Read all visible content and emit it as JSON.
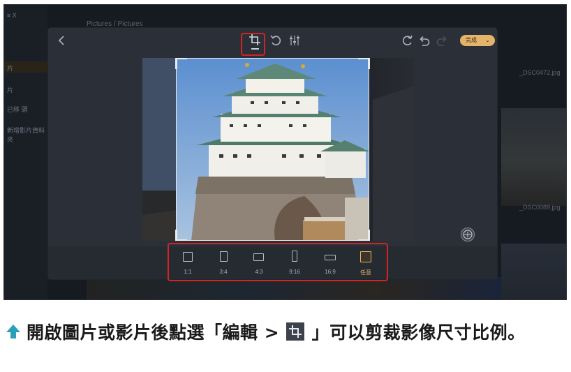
{
  "background": {
    "breadcrumb": "Pictures / Pictures",
    "sidebar_rows": [
      "≡  X",
      "片",
      "片",
      "已移 頭",
      "新增影片資料夾"
    ],
    "file_names": [
      "_DSC0472.jpg",
      "_DSC0089.jpg"
    ]
  },
  "editor": {
    "toolbar": {
      "back_icon": "chevron-left-icon",
      "crop_icon": "crop-icon",
      "rotate_icon": "rotate-icon",
      "adjust_icon": "adjust-icon",
      "redo_icon": "redo-icon",
      "undo_icon": "undo-icon",
      "done_label": "完成",
      "done_chevron": "⌄"
    },
    "ratios": [
      {
        "label": "1:1",
        "icon": "square-icon"
      },
      {
        "label": "3:4",
        "icon": "portrait-icon"
      },
      {
        "label": "4:3",
        "icon": "landscape-icon"
      },
      {
        "label": "9:16",
        "icon": "tall-portrait-icon"
      },
      {
        "label": "16:9",
        "icon": "wide-landscape-icon"
      },
      {
        "label": "任意",
        "icon": "freeform-icon",
        "selected": true
      }
    ],
    "compass_icon": "straighten-icon"
  },
  "caption": {
    "part1": "開啟圖片或影片後點選「編輯 > ",
    "part2": " 」可以剪裁影像尺寸比例。"
  },
  "colors": {
    "accent": "#e6b36a",
    "highlight": "#d32424",
    "caption_arrow": "#2aa0b8"
  }
}
